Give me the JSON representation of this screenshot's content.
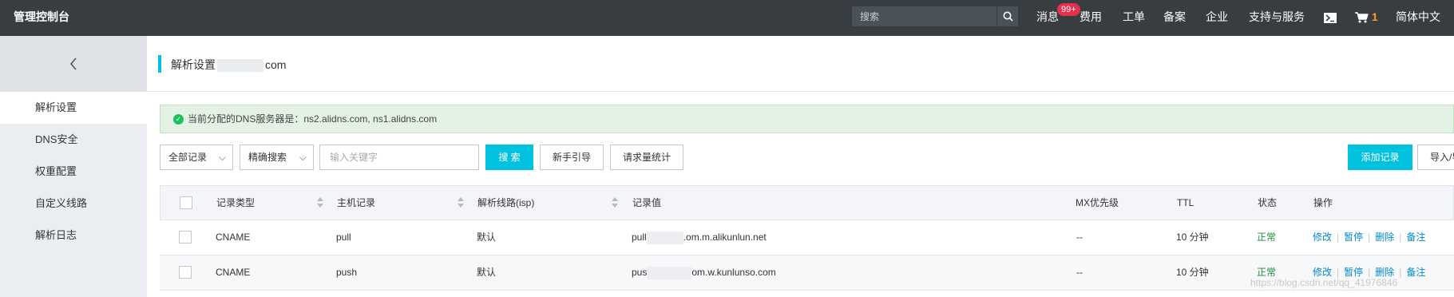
{
  "topbar": {
    "brand": "管理控制台",
    "search_placeholder": "搜索",
    "nav": {
      "messages": "消息",
      "messages_badge": "99+",
      "billing": "费用",
      "tickets": "工单",
      "filing": "备案",
      "enterprise": "企业",
      "support": "支持与服务",
      "cart_count": "1",
      "language": "简体中文"
    }
  },
  "sidebar": {
    "back_icon": "chevron-left-icon",
    "items": [
      {
        "label": "解析设置",
        "active": true
      },
      {
        "label": "DNS安全",
        "active": false
      },
      {
        "label": "权重配置",
        "active": false
      },
      {
        "label": "自定义线路",
        "active": false
      },
      {
        "label": "解析日志",
        "active": false
      }
    ]
  },
  "page": {
    "title_prefix": "解析设置",
    "title_suffix": "com"
  },
  "notice": {
    "text": "当前分配的DNS服务器是：ns2.alidns.com, ns1.alidns.com"
  },
  "toolbar": {
    "record_filter": "全部记录",
    "search_mode": "精确搜索",
    "keyword_placeholder": "输入关键字",
    "search_button": "搜 索",
    "guide_button": "新手引导",
    "stats_button": "请求量统计",
    "add_button": "添加记录",
    "import_button": "导入/导"
  },
  "table": {
    "columns": {
      "type": "记录类型",
      "host": "主机记录",
      "line": "解析线路(isp)",
      "value": "记录值",
      "mx": "MX优先级",
      "ttl": "TTL",
      "status": "状态",
      "actions": "操作"
    },
    "rows": [
      {
        "type": "CNAME",
        "host": "pull",
        "line": "默认",
        "value_prefix": "pull",
        "value_suffix": ".om.m.alikunlun.net",
        "mx": "--",
        "ttl": "10 分钟",
        "status": "正常"
      },
      {
        "type": "CNAME",
        "host": "push",
        "line": "默认",
        "value_prefix": "pus",
        "value_suffix": "om.w.kunlunso.com",
        "mx": "--",
        "ttl": "10 分钟",
        "status": "正常"
      }
    ],
    "actions": {
      "edit": "修改",
      "pause": "暂停",
      "delete": "删除",
      "note": "备注"
    }
  },
  "colors": {
    "topbar": "#373d41",
    "accent": "#00c1de",
    "ok": "#1e8e3e",
    "link": "#0088cc",
    "badge": "#e5304f"
  },
  "watermark": "https://blog.csdn.net/qq_41976846"
}
